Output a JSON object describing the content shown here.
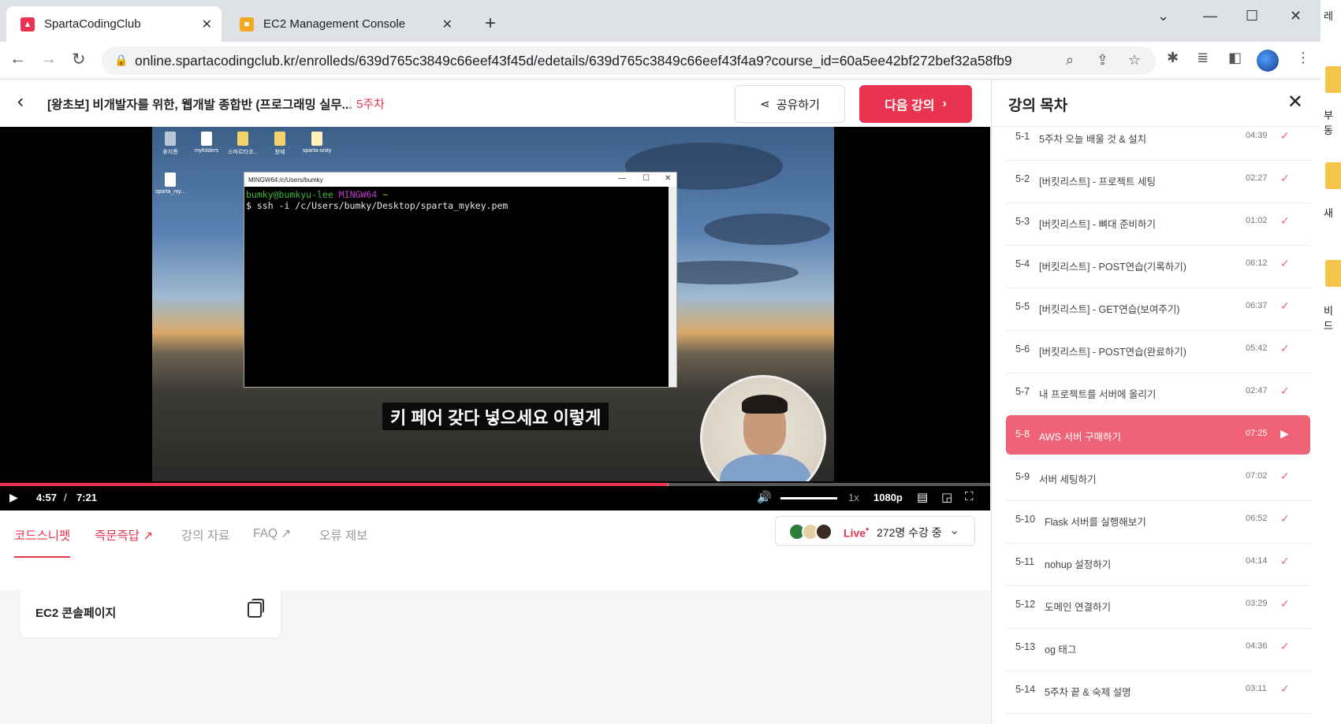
{
  "browser": {
    "tabs": [
      {
        "title": "SpartaCodingClub",
        "active": true
      },
      {
        "title": "EC2 Management Console",
        "active": false
      }
    ],
    "url": "online.spartacodingclub.kr/enrolleds/639d765c3849c66eef43f45d/edetails/639d765c3849c66eef43f4a9?course_id=60a5ee42bf272bef32a58fb9"
  },
  "header": {
    "course_title": "[왕초보] 비개발자를 위한, 웹개발 종합반 (프로그래밍 실무...",
    "week": "5주차",
    "share_label": "공유하기",
    "next_label": "다음 강의"
  },
  "video": {
    "desktop_icons": [
      "휴지통",
      "myfolders",
      "스파르타코...",
      "창예",
      "sparta-unity",
      "sparta_my..."
    ],
    "terminal_title": "MINGW64:/c/Users/bumky",
    "terminal_prompt_user": "bumky@bumkyu-lee",
    "terminal_prompt_env": "MINGW64",
    "terminal_prompt_dir": "~",
    "terminal_command": "$ ssh -i /c/Users/bumky/Desktop/sparta_mykey.pem",
    "subtitle": "키 페어 갖다 넣으세요 이렇게",
    "current_time": "4:57",
    "time_sep": "/",
    "duration": "7:21",
    "progress": 0.674,
    "speed": "1x",
    "quality": "1080p"
  },
  "content_tabs": [
    "코드스니펫",
    "즉문즉답",
    "강의 자료",
    "FAQ",
    "오류 제보"
  ],
  "live": {
    "label": "Live",
    "dot": "•",
    "count": "272명 수강 중"
  },
  "snippet_card": {
    "title": "EC2 콘솔페이지"
  },
  "sidebar": {
    "title": "강의 목차",
    "lectures": [
      {
        "num": "5-1",
        "title": "5주차 오늘 배울 것 & 설치",
        "duration": "04:39",
        "current": false
      },
      {
        "num": "5-2",
        "title": "[버킷리스트] - 프로젝트 세팅",
        "duration": "02:27",
        "current": false
      },
      {
        "num": "5-3",
        "title": "[버킷리스트] - 뼈대 준비하기",
        "duration": "01:02",
        "current": false
      },
      {
        "num": "5-4",
        "title": "[버킷리스트] - POST연습(기록하기)",
        "duration": "06:12",
        "current": false
      },
      {
        "num": "5-5",
        "title": "[버킷리스트] - GET연습(보여주기)",
        "duration": "06:37",
        "current": false
      },
      {
        "num": "5-6",
        "title": "[버킷리스트] - POST연습(완료하기)",
        "duration": "05:42",
        "current": false
      },
      {
        "num": "5-7",
        "title": "내 프로젝트를 서버에 올리기",
        "duration": "02:47",
        "current": false
      },
      {
        "num": "5-8",
        "title": "AWS 서버 구매하기",
        "duration": "07:25",
        "current": true
      },
      {
        "num": "5-9",
        "title": "서버 세팅하기",
        "duration": "07:02",
        "current": false
      },
      {
        "num": "5-10",
        "title": "Flask 서버를 실행해보기",
        "duration": "06:52",
        "current": false
      },
      {
        "num": "5-11",
        "title": "nohup 설정하기",
        "duration": "04:14",
        "current": false
      },
      {
        "num": "5-12",
        "title": "도메인 연결하기",
        "duration": "03:29",
        "current": false
      },
      {
        "num": "5-13",
        "title": "og 태그",
        "duration": "04:36",
        "current": false
      },
      {
        "num": "5-14",
        "title": "5주차 끝 & 숙제 설명",
        "duration": "03:11",
        "current": false
      }
    ]
  },
  "desktop_edge": {
    "labels": [
      "레",
      "부동",
      "새",
      "비드"
    ]
  },
  "colors": {
    "accent": "#e8344e",
    "current_lecture": "#f06377"
  }
}
